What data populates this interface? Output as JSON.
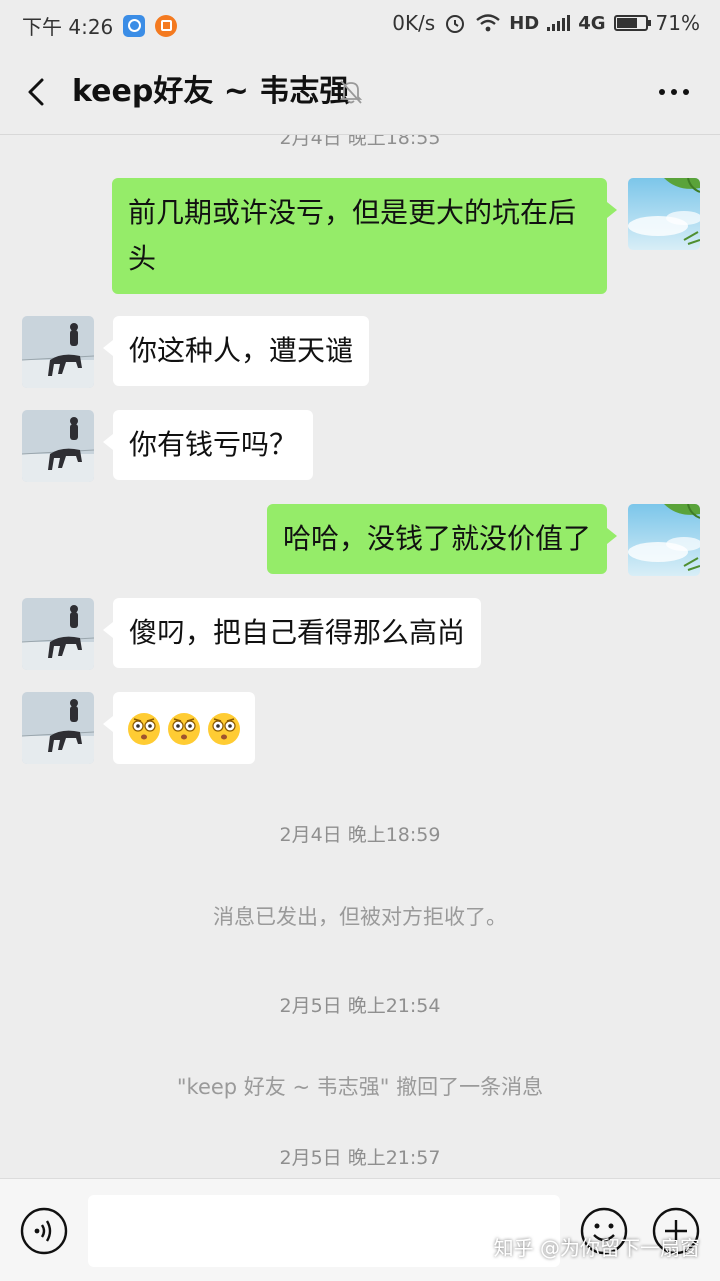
{
  "status_bar": {
    "time": "下午 4:26",
    "net_speed": "0K/s",
    "hd": "HD",
    "network": "4G",
    "battery": "71%",
    "battery_level": 0.71
  },
  "header": {
    "title": "keep好友 ~ 韦志强"
  },
  "chat": {
    "top_timestamp": "2月4日 晚上18:55",
    "messages": [
      {
        "from": "me",
        "text": "前几期或许没亏，但是更大的坑在后头"
      },
      {
        "from": "friend",
        "text": "你这种人，遭天谴"
      },
      {
        "from": "friend",
        "text": "你有钱亏吗？"
      },
      {
        "from": "me",
        "text": "哈哈，没钱了就没价值了"
      },
      {
        "from": "friend",
        "text": "傻叼，把自己看得那么高尚"
      },
      {
        "from": "friend",
        "emoji_count": 3,
        "emoji": "wide-eyed-face-icon"
      }
    ],
    "timestamp_1": "2月4日 晚上18:59",
    "system_1": "消息已发出，但被对方拒收了。",
    "timestamp_2": "2月5日 晚上21:54",
    "system_2": "\"keep 好友 ~ 韦志强\" 撤回了一条消息",
    "timestamp_3": "2月5日 晚上21:57"
  },
  "input_bar": {
    "value": "",
    "watermark": "知乎 @为你留下一扇窗"
  },
  "colors": {
    "background": "#ededed",
    "my_bubble": "#95ec69",
    "friend_bubble": "#ffffff",
    "timestamp": "#8f8f8f"
  }
}
